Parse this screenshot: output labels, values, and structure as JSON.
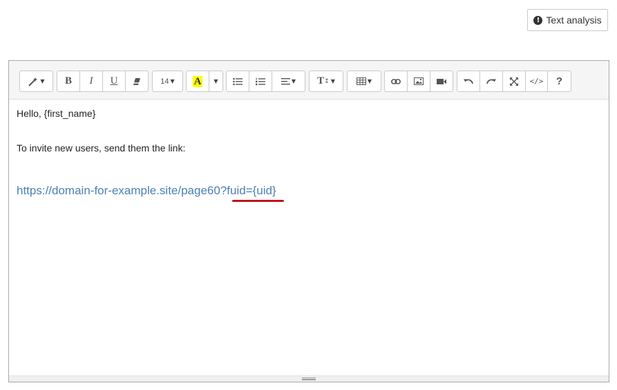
{
  "header": {
    "text_analysis_label": "Text analysis",
    "text_analysis_icon": "info-circle-icon"
  },
  "toolbar": {
    "font_size_value": "14",
    "bold_label": "B",
    "italic_label": "I",
    "underline_label": "U",
    "font_color_label": "A",
    "font_color_highlight": "#ffff00",
    "text_size_label": "T",
    "help_label": "?",
    "icons": [
      "magic-style-icon",
      "bold-icon",
      "italic-icon",
      "underline-icon",
      "eraser-icon",
      "font-color-icon",
      "unordered-list-icon",
      "ordered-list-icon",
      "align-icon",
      "line-height-icon",
      "table-icon",
      "link-icon",
      "image-icon",
      "video-icon",
      "undo-icon",
      "redo-icon",
      "fullscreen-icon",
      "code-view-icon",
      "help-icon"
    ]
  },
  "content": {
    "greeting": "Hello, {first_name}",
    "instruction": "To invite new users, send them the link:",
    "link_text": "https://domain-for-example.site/page60?fuid={uid}"
  },
  "colors": {
    "link": "#4a7fb5",
    "underline_mark": "#c0141a"
  }
}
